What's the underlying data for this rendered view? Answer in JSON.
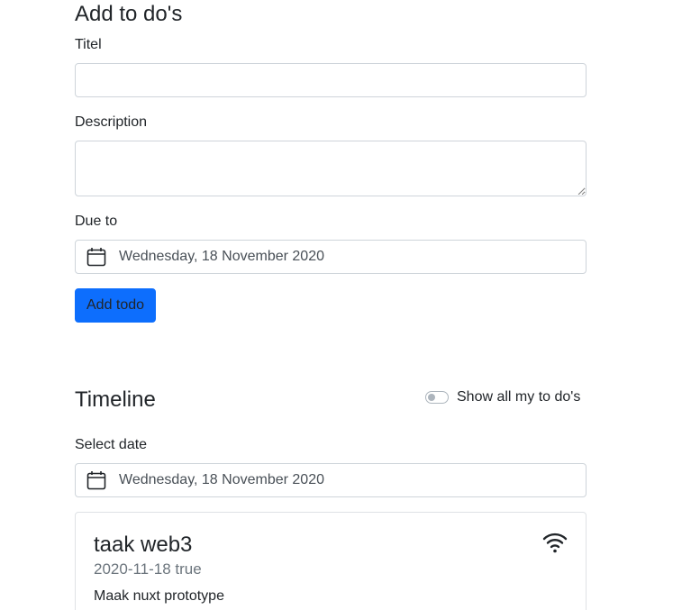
{
  "add_section": {
    "title": "Add to do's",
    "title_label": "Titel",
    "title_value": "",
    "description_label": "Description",
    "description_value": "",
    "due_label": "Due to",
    "due_date": "Wednesday, 18 November 2020",
    "add_button": "Add todo"
  },
  "timeline": {
    "title": "Timeline",
    "toggle_label": "Show all my to do's",
    "toggle_on": false,
    "select_date_label": "Select date",
    "selected_date": "Wednesday, 18 November 2020"
  },
  "todos": [
    {
      "title": "taak web3",
      "subtitle": "2020-11-18 true",
      "text": "Maak nuxt prototype",
      "icon": "wifi-icon"
    }
  ],
  "colors": {
    "primary": "#0d6efd",
    "border": "#ced4da",
    "muted": "#6c757d"
  }
}
